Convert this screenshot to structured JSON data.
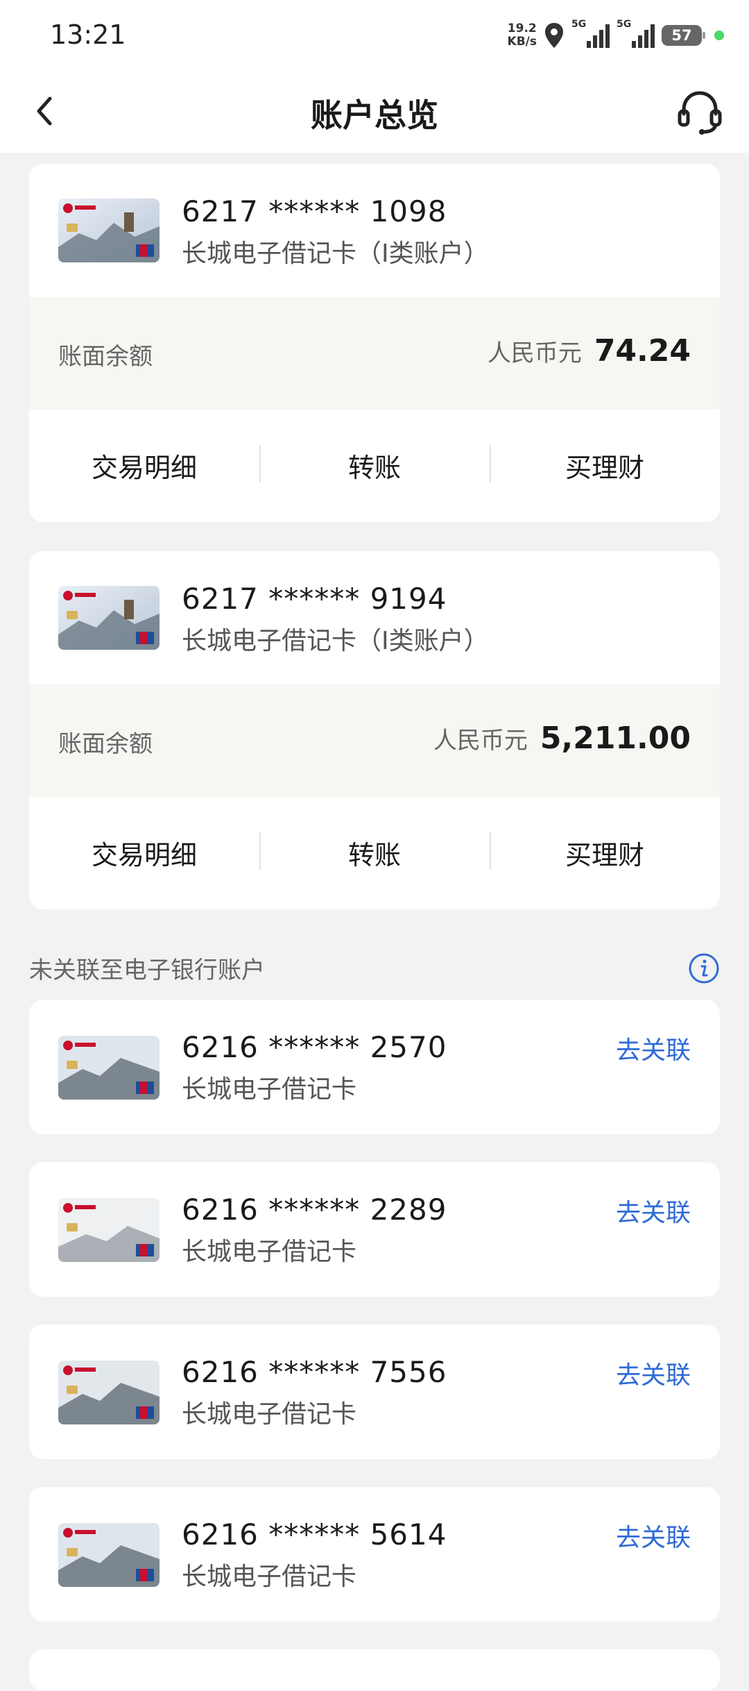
{
  "status_bar": {
    "time": "13:21",
    "speed_value": "19.2",
    "speed_unit": "KB/s",
    "network1": "5G",
    "network2": "5G",
    "battery": "57"
  },
  "nav": {
    "title": "账户总览"
  },
  "linked_accounts": [
    {
      "number": "6217 ****** 1098",
      "type": "长城电子借记卡（I类账户）",
      "balance_label": "账面余额",
      "currency": "人民币元",
      "amount": "74.24",
      "actions": [
        "交易明细",
        "转账",
        "买理财"
      ]
    },
    {
      "number": "6217 ****** 9194",
      "type": "长城电子借记卡（I类账户）",
      "balance_label": "账面余额",
      "currency": "人民币元",
      "amount": "5,211.00",
      "actions": [
        "交易明细",
        "转账",
        "买理财"
      ]
    }
  ],
  "unlinked_section": {
    "title": "未关联至电子银行账户"
  },
  "unlinked_accounts": [
    {
      "number": "6216 ****** 2570",
      "type": "长城电子借记卡",
      "action": "去关联"
    },
    {
      "number": "6216 ****** 2289",
      "type": "长城电子借记卡",
      "action": "去关联"
    },
    {
      "number": "6216 ****** 7556",
      "type": "长城电子借记卡",
      "action": "去关联"
    },
    {
      "number": "6216 ****** 5614",
      "type": "长城电子借记卡",
      "action": "去关联"
    }
  ],
  "colors": {
    "link": "#2f6bd6",
    "background": "#f2f2f2",
    "balance_bg": "#f8f6f3"
  }
}
